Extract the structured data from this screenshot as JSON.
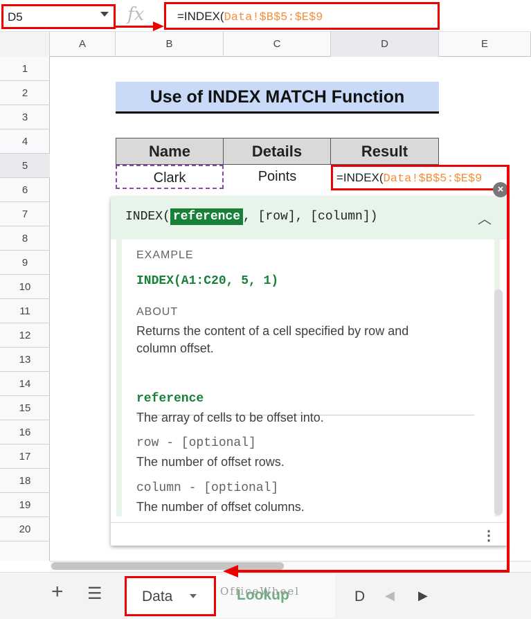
{
  "formula_bar": {
    "name_box": "D5",
    "fx": "fx",
    "formula_prefix": "=INDEX(",
    "formula_ref": "Data!$B$5:$E$9"
  },
  "columns": [
    "A",
    "B",
    "C",
    "D",
    "E"
  ],
  "rows": [
    "1",
    "2",
    "3",
    "4",
    "5",
    "6",
    "7",
    "8",
    "9",
    "10",
    "11",
    "12",
    "13",
    "14",
    "15",
    "16",
    "17",
    "18",
    "19",
    "20"
  ],
  "sheet": {
    "title": "Use of INDEX MATCH Function",
    "headers": [
      "Name",
      "Details",
      "Result"
    ],
    "row5": {
      "name": "Clark",
      "details": "Points",
      "result_prefix": "=INDEX(",
      "result_ref": "Data!$B$5:$E$9"
    }
  },
  "popup": {
    "signature_prefix": "INDEX(",
    "signature_highlight": "reference",
    "signature_rest": ", [row], [column])",
    "example_label": "EXAMPLE",
    "example": "INDEX(A1:C20, 5, 1)",
    "about_label": "ABOUT",
    "about_line1": "Returns the content of a cell specified by row and",
    "about_line2": "column offset.",
    "params": [
      {
        "name": "reference",
        "desc": "The array of cells to be offset into."
      },
      {
        "name": "row - [optional]",
        "desc": "The number of offset rows."
      },
      {
        "name": "column - [optional]",
        "desc": "The number of offset columns."
      }
    ]
  },
  "tabs": {
    "data": "Data",
    "lookup": "Lookup",
    "d": "D",
    "watermark": "OfficeWheel"
  }
}
